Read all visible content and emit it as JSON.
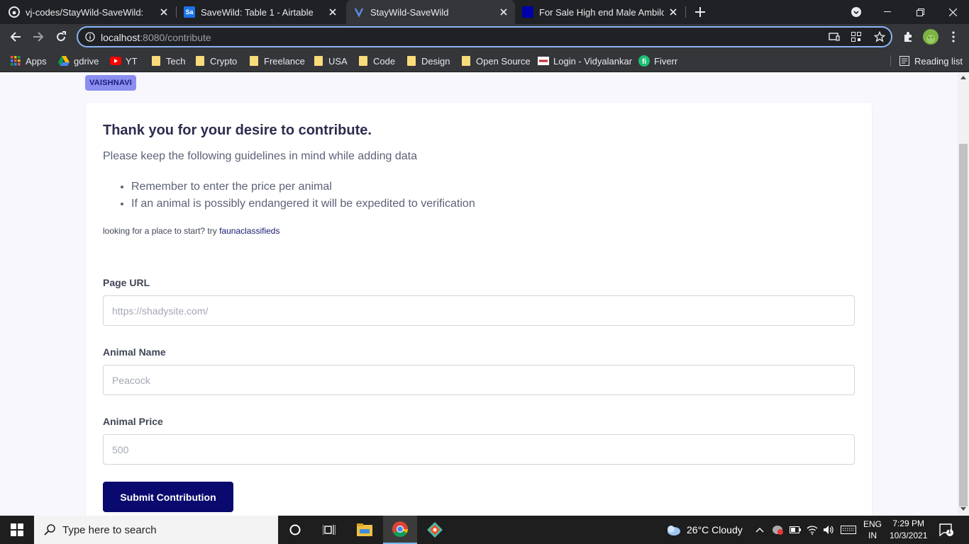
{
  "browser": {
    "tabs": [
      {
        "title": "vj-codes/StayWild-SaveWild: My",
        "active": false
      },
      {
        "title": "SaveWild: Table 1 - Airtable",
        "active": false
      },
      {
        "title": "StayWild-SaveWild",
        "active": true
      },
      {
        "title": "For Sale High end Male Ambilobe",
        "active": false
      }
    ],
    "url_host": "localhost",
    "url_rest": ":8080/contribute",
    "bookmarks": [
      "Apps",
      "gdrive",
      "YT",
      "Tech",
      "Crypto",
      "Freelance",
      "USA",
      "Code",
      "Design",
      "Open Source",
      "Login - Vidyalankar",
      "Fiverr"
    ],
    "reading_list": "Reading list"
  },
  "page": {
    "user_badge": "VAISHNAVI",
    "heading": "Thank you for your desire to contribute.",
    "subheading": "Please keep the following guidelines in mind while adding data",
    "guidelines": [
      "Remember to enter the price per animal",
      "If an animal is possibly endangered it will be expedited to verification"
    ],
    "hint_text": "looking for a place to start? try ",
    "hint_link": "faunaclassifieds",
    "form": {
      "url_label": "Page URL",
      "url_placeholder": "https://shadysite.com/",
      "name_label": "Animal Name",
      "name_placeholder": "Peacock",
      "price_label": "Animal Price",
      "price_placeholder": "500",
      "submit_label": "Submit Contribution"
    }
  },
  "taskbar": {
    "search_placeholder": "Type here to search",
    "weather": "26°C  Cloudy",
    "lang_top": "ENG",
    "lang_bottom": "IN",
    "time": "7:29 PM",
    "date": "10/3/2021",
    "notifications": "1"
  },
  "colors": {
    "accent": "#0a0a6e",
    "badge": "#8b8ef0",
    "omnibox_focus": "#8ab4f8"
  }
}
